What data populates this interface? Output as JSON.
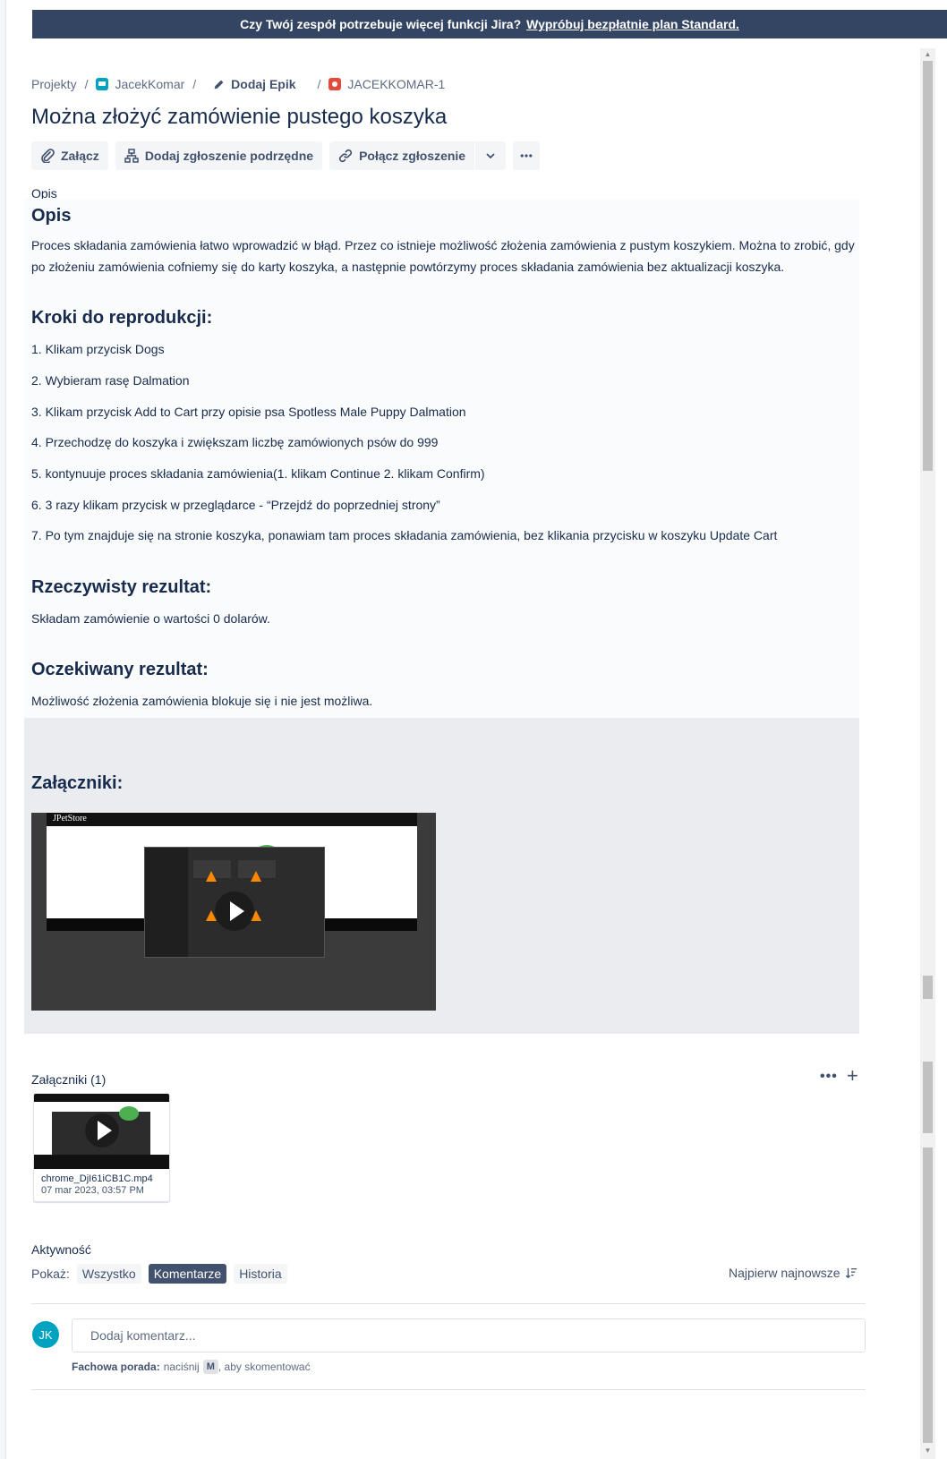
{
  "banner": {
    "question": "Czy Twój zespół potrzebuje więcej funkcji Jira?",
    "link": "Wypróbuj bezpłatnie plan Standard."
  },
  "breadcrumb": {
    "projects": "Projekty",
    "project": "JacekKomar",
    "epic": "Dodaj Epik",
    "issue_key": "JACEKKOMAR-1",
    "separator": "/"
  },
  "issue": {
    "title": "Można złożyć zamówienie pustego koszyka"
  },
  "toolbar": {
    "attach": "Załącz",
    "add_child": "Dodaj zgłoszenie podrzędne",
    "link_issue": "Połącz zgłoszenie"
  },
  "description": {
    "field_label": "Opis",
    "heading": "Opis",
    "body": "Proces składania zamówienia łatwo wprowadzić w błąd. Przez co istnieje możliwość złożenia zamówienia z pustym koszykiem. Można to zrobić, gdy po złożeniu zamówienia cofniemy się do karty koszyka, a następnie powtórzymy proces składania zamówienia bez aktualizacji koszyka.",
    "steps_heading": "Kroki do reprodukcji:",
    "steps": [
      "1. Klikam przycisk Dogs",
      "2. Wybieram rasę Dalmation",
      "3. Klikam przycisk Add to Cart przy opisie psa Spotless Male Puppy Dalmation",
      "4. Przechodzę do koszyka i zwiększam liczbę zamówionych psów do 999",
      "5. kontynuuje proces składania zamówienia(1. klikam Continue 2. klikam Confirm)",
      "6. 3 razy klikam przycisk w przeglądarce - “Przejdź do poprzedniej strony”",
      "7. Po tym znajduje się na stronie koszyka, ponawiam tam proces składania zamówienia, bez klikania przycisku w koszyku Update Cart"
    ],
    "actual_heading": "Rzeczywisty rezultat:",
    "actual": "Składam zamówienie o wartości 0 dolarów.",
    "expected_heading": "Oczekiwany rezultat:",
    "expected": "Możliwość złożenia zamówienia blokuje się i nie jest możliwa.",
    "attachments_heading": "Załączniki:",
    "video_logo": "JPetStore"
  },
  "attachments": {
    "title": "Załączniki (1)",
    "more": "•••",
    "add": "+",
    "file": {
      "name": "chrome_DjI61iCB1C.mp4",
      "date": "07 mar 2023, 03:57 PM"
    }
  },
  "activity": {
    "title": "Aktywność",
    "show_label": "Pokaż:",
    "filters": [
      "Wszystko",
      "Komentarze",
      "Historia"
    ],
    "active_filter": "Komentarze",
    "sort": "Najpierw najnowsze",
    "avatar_initials": "JK",
    "comment_placeholder": "Dodaj komentarz...",
    "tip_bold": "Fachowa porada:",
    "tip_press": "naciśnij",
    "tip_key": "M",
    "tip_rest": ", aby skomentować"
  },
  "colors": {
    "banner": "#344563",
    "text": "#172b4d",
    "muted": "#5e6c84",
    "active_pill": "#42526e",
    "avatar": "#00a3bf",
    "bug": "#e5493a"
  }
}
